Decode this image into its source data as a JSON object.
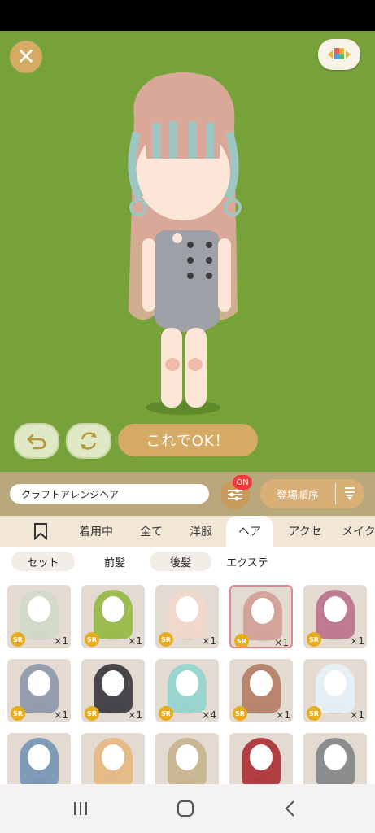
{
  "screen": {
    "ok_button_label": "これでOK！",
    "search_value": "クラフトアレンジヘア",
    "filter_badge": "ON",
    "sort_label": "登場順序"
  },
  "tabs": [
    {
      "label": "",
      "icon": "bookmark-icon"
    },
    {
      "label": "着用中"
    },
    {
      "label": "全て"
    },
    {
      "label": "洋服"
    },
    {
      "label": "ヘア",
      "active": true
    },
    {
      "label": "アクセ"
    },
    {
      "label": "メイク"
    }
  ],
  "subtabs": [
    {
      "label": "セット"
    },
    {
      "label": "前髪",
      "active": true
    },
    {
      "label": "後髪"
    },
    {
      "label": "エクステ"
    }
  ],
  "items": [
    {
      "rarity": "SR",
      "count": "×1",
      "hair_color": "#cfd9c8"
    },
    {
      "rarity": "SR",
      "count": "×1",
      "hair_color": "#8fb63a"
    },
    {
      "rarity": "SR",
      "count": "×1",
      "hair_color": "#f2d7cc"
    },
    {
      "rarity": "SR",
      "count": "×1",
      "hair_color": "#cf9a91",
      "selected": true
    },
    {
      "rarity": "SR",
      "count": "×1",
      "hair_color": "#b96a87"
    },
    {
      "rarity": "SR",
      "count": "×1",
      "hair_color": "#8793a8"
    },
    {
      "rarity": "SR",
      "count": "×1",
      "hair_color": "#2d2b33"
    },
    {
      "rarity": "SR",
      "count": "×4",
      "hair_color": "#8ed4cf"
    },
    {
      "rarity": "SR",
      "count": "×1",
      "hair_color": "#b0765e"
    },
    {
      "rarity": "SR",
      "count": "×1",
      "hair_color": "#e6f2fa"
    },
    {
      "rarity": "",
      "count": "",
      "hair_color": "#6f8fb3"
    },
    {
      "rarity": "",
      "count": "",
      "hair_color": "#e8b57a"
    },
    {
      "rarity": "",
      "count": "",
      "hair_color": "#c5b08a"
    },
    {
      "rarity": "",
      "count": "",
      "hair_color": "#a8222a"
    },
    {
      "rarity": "",
      "count": "",
      "hair_color": "#7c7f84"
    }
  ],
  "colors": {
    "stage_background": "#77a23a",
    "accent_gold": "#d4aa65",
    "sr_badge": "#e8ac1c",
    "selected_border": "#e2868e",
    "on_badge": "#ef3a3a"
  }
}
